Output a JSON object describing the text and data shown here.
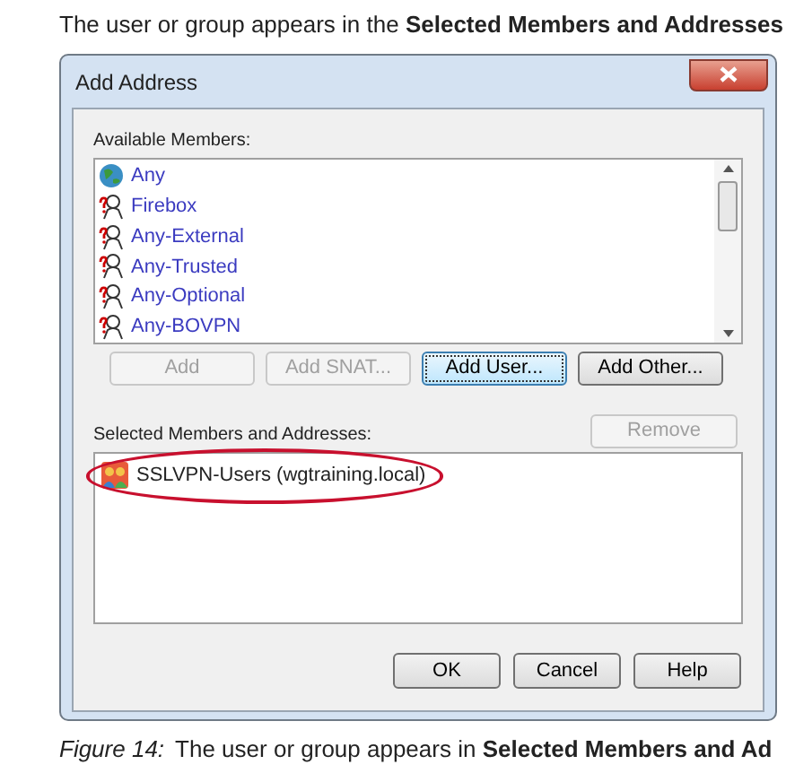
{
  "intro": "The user or group appears in the **Selected Members and Addresses**",
  "window": {
    "title": "Add Address"
  },
  "available": {
    "label": "Available Members:",
    "items": [
      {
        "name": "Any",
        "kind": "globe"
      },
      {
        "name": "Firebox",
        "kind": "alias"
      },
      {
        "name": "Any-External",
        "kind": "alias"
      },
      {
        "name": "Any-Trusted",
        "kind": "alias"
      },
      {
        "name": "Any-Optional",
        "kind": "alias"
      },
      {
        "name": "Any-BOVPN",
        "kind": "alias"
      }
    ]
  },
  "add_buttons": [
    {
      "label": "Add",
      "disabled": true,
      "focused": false
    },
    {
      "label": "Add SNAT...",
      "disabled": true,
      "focused": false
    },
    {
      "label": "Add User...",
      "disabled": false,
      "focused": true
    },
    {
      "label": "Add Other...",
      "disabled": false,
      "focused": false
    }
  ],
  "selected": {
    "label": "Selected Members and Addresses:",
    "remove": {
      "label": "Remove",
      "disabled": true
    },
    "items": [
      {
        "name": "SSLVPN-Users (wgtraining.local)",
        "highlighted": true
      }
    ]
  },
  "footer_buttons": [
    {
      "label": "OK"
    },
    {
      "label": "Cancel"
    },
    {
      "label": "Help"
    }
  ],
  "caption": {
    "label": "Figure 14:",
    "text": "The user or group appears in **Selected Members and Ad**"
  }
}
